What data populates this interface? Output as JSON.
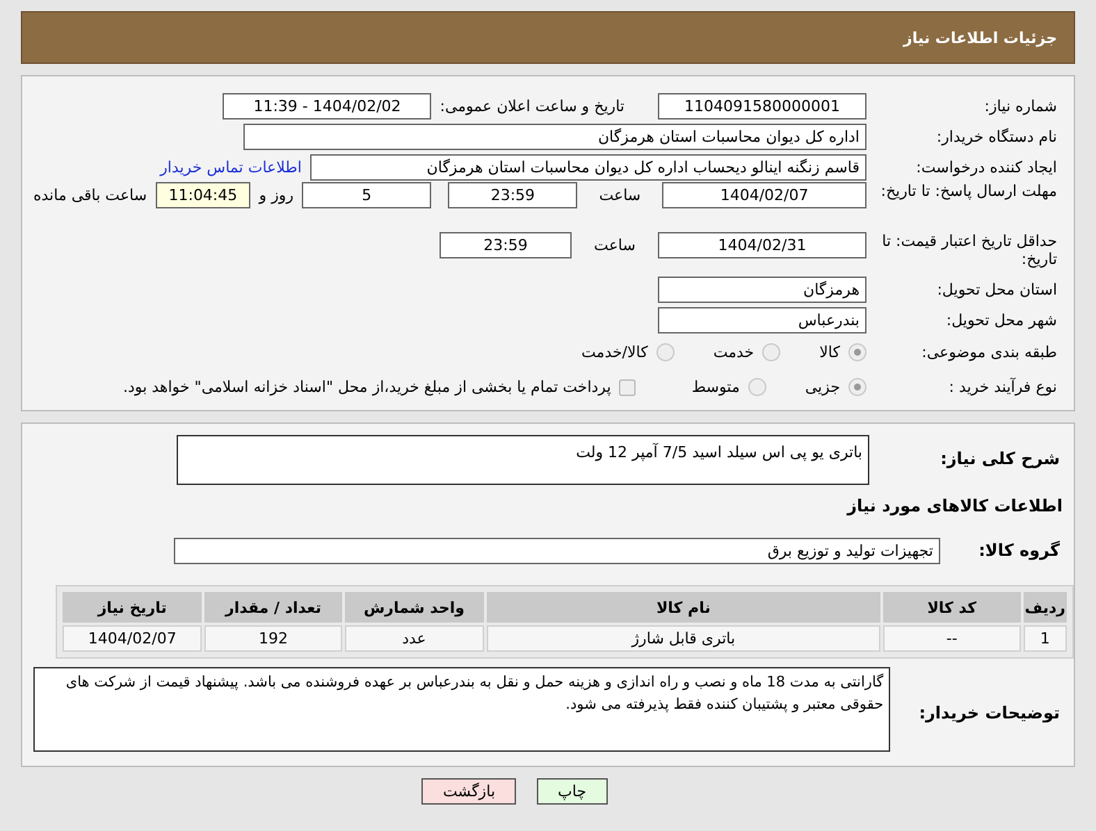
{
  "header": {
    "title": "جزئیات اطلاعات نیاز"
  },
  "need_number": {
    "label": "شماره نیاز:",
    "value": "1104091580000001"
  },
  "announce": {
    "label": "تاریخ و ساعت اعلان عمومی:",
    "value": "1404/02/02 - 11:39"
  },
  "buyer_org": {
    "label": "نام دستگاه خریدار:",
    "value": "اداره کل دیوان محاسبات استان هرمزگان"
  },
  "requester": {
    "label": "ایجاد کننده درخواست:",
    "value": "قاسم زنگنه اینالو دیحساب اداره کل دیوان محاسبات استان هرمزگان",
    "link": "اطلاعات تماس خریدار"
  },
  "deadline": {
    "label": "مهلت ارسال پاسخ: تا تاریخ:",
    "date": "1404/02/07",
    "time_label": "ساعت",
    "time": "23:59",
    "days": "5",
    "days_label": "روز و",
    "remaining": "11:04:45",
    "remaining_label": "ساعت باقی مانده"
  },
  "validity": {
    "label": "حداقل تاریخ اعتبار قیمت: تا تاریخ:",
    "date": "1404/02/31",
    "time_label": "ساعت",
    "time": "23:59"
  },
  "province": {
    "label": "استان محل تحویل:",
    "value": "هرمزگان"
  },
  "city": {
    "label": "شهر محل تحویل:",
    "value": "بندرعباس"
  },
  "category": {
    "label": "طبقه بندی موضوعی:",
    "options": [
      {
        "label": "کالا",
        "selected": true
      },
      {
        "label": "خدمت",
        "selected": false
      },
      {
        "label": "کالا/خدمت",
        "selected": false
      }
    ]
  },
  "process": {
    "label": "نوع فرآیند خرید :",
    "options": [
      {
        "label": "جزیی",
        "selected": true
      },
      {
        "label": "متوسط",
        "selected": false
      }
    ],
    "treasury": {
      "checked": false,
      "text": "پرداخت تمام یا بخشی از مبلغ خرید،از محل \"اسناد خزانه اسلامی\" خواهد بود."
    }
  },
  "description": {
    "label": "شرح کلی نیاز:",
    "value": "باتری یو پی اس سیلد اسید 7/5 آمپر 12 ولت"
  },
  "items_heading": "اطلاعات کالاهای مورد نیاز",
  "goods_group": {
    "label": "گروه کالا:",
    "value": "تجهیزات تولید و توزیع برق"
  },
  "table": {
    "columns": [
      "ردیف",
      "کد کالا",
      "نام کالا",
      "واحد شمارش",
      "تعداد / مقدار",
      "تاریخ نیاز"
    ],
    "rows": [
      [
        "1",
        "--",
        "باتری قابل شارژ",
        "عدد",
        "192",
        "1404/02/07"
      ]
    ]
  },
  "buyer_notes": {
    "label": "توضیحات خریدار:",
    "value": "گارانتی به مدت 18 ماه و نصب و راه اندازی و هزینه حمل و نقل به بندرعباس بر عهده فروشنده می باشد. پیشنهاد قیمت از شرکت های حقوقی معتبر و پشتیبان کننده فقط پذیرفته می شود."
  },
  "buttons": [
    {
      "label": "چاپ",
      "kind": "print"
    },
    {
      "label": "بازگشت",
      "kind": "back"
    }
  ]
}
